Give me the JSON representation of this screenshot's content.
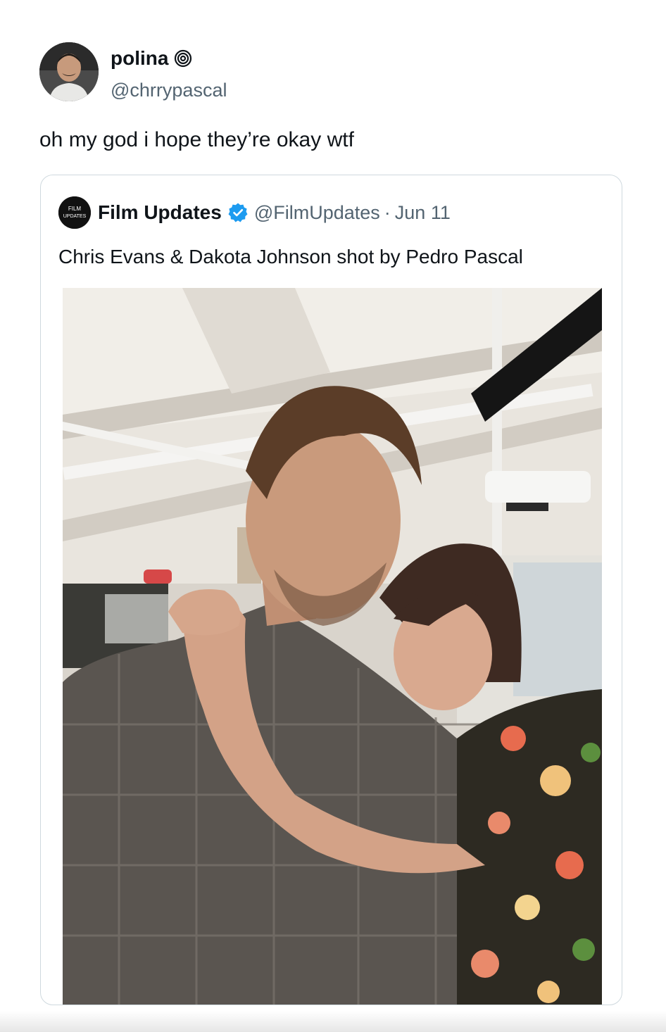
{
  "tweet": {
    "author_name": "polina",
    "author_badge_icon": "spiral-icon",
    "handle": "@chrrypascal",
    "text": "oh my god i hope they’re okay wtf"
  },
  "quoted": {
    "avatar_label_line1": "FILM",
    "avatar_label_line2": "UPDATES",
    "name": "Film Updates",
    "verified_icon": "verified-badge-icon",
    "verified_color": "#1d9bf0",
    "handle": "@FilmUpdates",
    "separator": "·",
    "date": "Jun 11",
    "text": "Chris Evans & Dakota Johnson shot by Pedro Pascal",
    "media_description_icon": "photo"
  },
  "colors": {
    "text_primary": "#0f1419",
    "text_secondary": "#536471",
    "border": "#cfd9de"
  }
}
